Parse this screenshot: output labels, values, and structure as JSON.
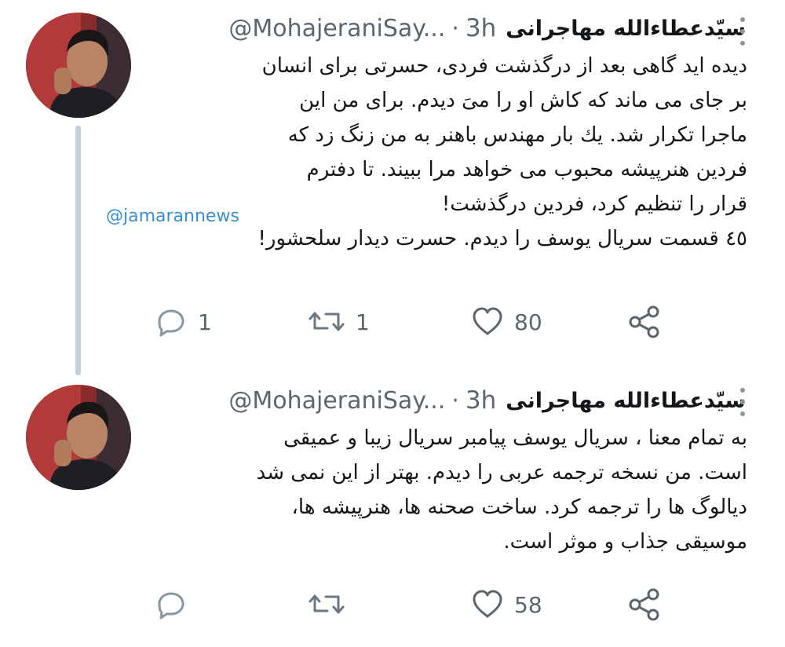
{
  "watermark": "@jamarannews",
  "tweets": [
    {
      "author_name": "سیّدعطاءالله مهاجرانی",
      "handle": "@MohajeraniSay...",
      "separator": "·",
      "time": "3h",
      "lines": [
        "دیده اید گاهی بعد از درگذشت فردی، حسرتی برای انسان",
        "بر جای می ماند که کاش او را میَ دیدم. برای من این",
        "ماجرا تکرار شد. یك بار مهندس باهنر به من زنگ زد که",
        "فردین هنرپیشه محبوب می خواهد مرا ببیند. تا دفترم",
        "قرار را تنظیم کرد، فردین درگذشت!",
        "٤٥ قسمت سریال یوسف را دیدم. حسرت دیدار سلحشور!"
      ],
      "reply_count": "1",
      "retweet_count": "1",
      "like_count": "80"
    },
    {
      "author_name": "سیّدعطاءالله مهاجرانی",
      "handle": "@MohajeraniSay...",
      "separator": "·",
      "time": "3h",
      "lines": [
        "به تمام معنا ، سریال یوسف پیامبر سریال زیبا و عمیقی",
        "است. من نسخه ترجمه عربی را دیدم. بهتر از این نمی شد",
        "دیالوگ ها را ترجمه کرد. ساخت صحنه ها، هنرپیشه ها،",
        "موسیقی جذاب و موثر است."
      ],
      "reply_count": "",
      "retweet_count": "",
      "like_count": "58"
    }
  ],
  "icons": {
    "reply": "reply-icon",
    "retweet": "retweet-icon",
    "like": "heart-icon",
    "share": "share-icon",
    "more": "more-vertical-icon"
  },
  "colors": {
    "text": "#14171a",
    "muted": "#5b6670",
    "thread_line": "#c4cfd6",
    "watermark": "#3a8fd0"
  }
}
